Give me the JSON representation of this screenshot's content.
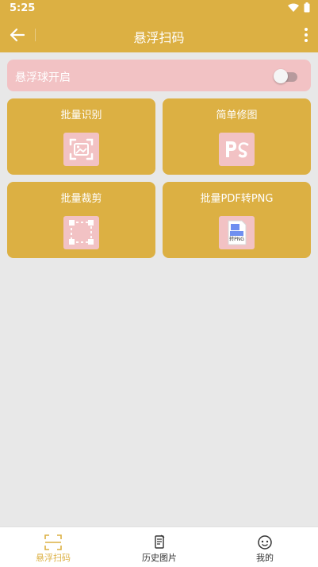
{
  "status_bar": {
    "time": "5:25"
  },
  "app_bar": {
    "title": "悬浮扫码"
  },
  "toggle": {
    "label": "悬浮球开启",
    "enabled": false
  },
  "cards": [
    {
      "label": "批量识别",
      "icon": "image-scan-icon"
    },
    {
      "label": "简单修图",
      "icon": "ps-icon"
    },
    {
      "label": "批量裁剪",
      "icon": "crop-icon"
    },
    {
      "label": "批量PDF转PNG",
      "icon": "pdf-to-png-icon",
      "icon_text": "转PNG"
    }
  ],
  "bottom_nav": [
    {
      "label": "悬浮扫码",
      "icon": "scan-icon",
      "active": true
    },
    {
      "label": "历史图片",
      "icon": "history-icon",
      "active": false
    },
    {
      "label": "我的",
      "icon": "profile-icon",
      "active": false
    }
  ],
  "colors": {
    "primary": "#dcb043",
    "accent_pink": "#f2c2c4",
    "background": "#e8e8e8"
  }
}
